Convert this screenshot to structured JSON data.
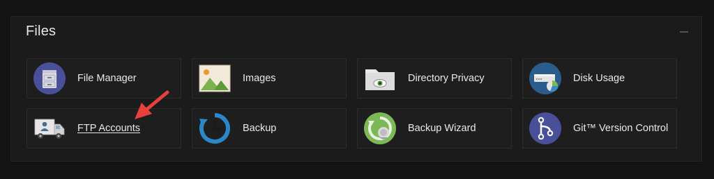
{
  "section": {
    "title": "Files"
  },
  "tiles": [
    {
      "label": "File Manager",
      "icon": "file-cabinet-icon"
    },
    {
      "label": "Images",
      "icon": "image-landscape-icon"
    },
    {
      "label": "Directory Privacy",
      "icon": "folder-eye-icon"
    },
    {
      "label": "Disk Usage",
      "icon": "disk-drive-chart-icon"
    },
    {
      "label": "FTP Accounts",
      "icon": "delivery-truck-user-icon"
    },
    {
      "label": "Backup",
      "icon": "backup-clock-icon"
    },
    {
      "label": "Backup Wizard",
      "icon": "backup-wizard-icon"
    },
    {
      "label": "Git™ Version Control",
      "icon": "git-branch-icon"
    }
  ],
  "colors": {
    "accent_blue": "#2b87c8",
    "arrow_red": "#e6413a",
    "green": "#7cb856",
    "purple": "#4a4f9a"
  }
}
